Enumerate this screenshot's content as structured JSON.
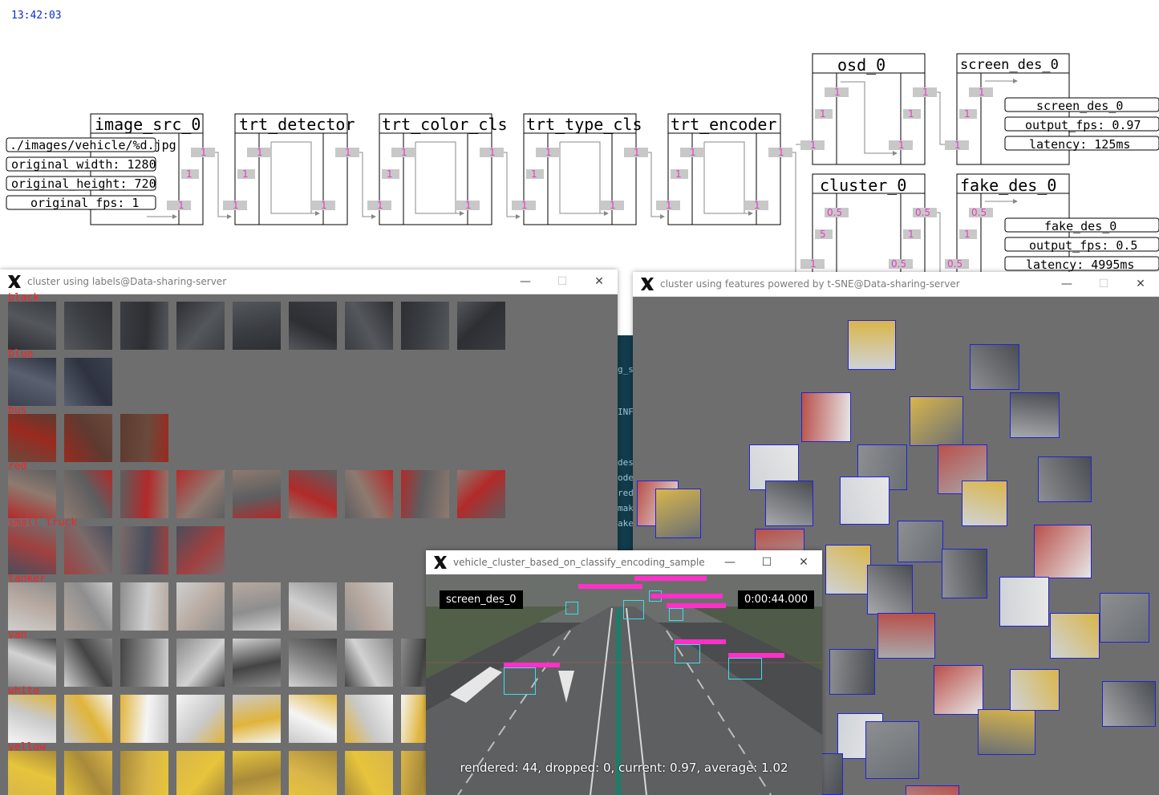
{
  "clock": "13:42:03",
  "pipeline": {
    "nodes": [
      {
        "name": "image_src_0"
      },
      {
        "name": "trt_detector"
      },
      {
        "name": "trt_color_cls"
      },
      {
        "name": "trt_type_cls"
      },
      {
        "name": "trt_encoder"
      },
      {
        "name": "osd_0"
      },
      {
        "name": "screen_des_0"
      },
      {
        "name": "cluster_0"
      },
      {
        "name": "fake_des_0"
      }
    ],
    "image_src_info": [
      "./images/vehicle/%d.jpg",
      "original_width: 1280",
      "original_height: 720",
      "original_fps: 1"
    ],
    "screen_des_info": [
      "screen_des_0",
      "output_fps: 0.97",
      "latency: 125ms"
    ],
    "fake_des_info": [
      "fake_des_0",
      "output_fps: 0.5",
      "latency: 4995ms"
    ],
    "port_values": {
      "one": "1",
      "half": "0.5",
      "five": "5"
    }
  },
  "win_labels": {
    "title": "cluster using labels@Data-sharing-server",
    "categories": [
      "black",
      "blue",
      "bus",
      "red",
      "small_truck",
      "tanker",
      "van",
      "white",
      "yellow"
    ]
  },
  "win_features": {
    "title": "cluster using features powered by t-SNE@Data-sharing-server"
  },
  "win_video": {
    "title": "vehicle_cluster_based_on_classify_encoding_sample",
    "overlay_left": "screen_des_0",
    "overlay_right": "0:00:44.000",
    "stats": "rendered: 44, dropped: 0, current: 0.97, average: 1.02"
  },
  "terminal_fragments": [
    "g_s",
    "INF",
    "des",
    "ode",
    "red",
    "mak",
    "ake"
  ],
  "window_controls": {
    "minimize": "—",
    "maximize": "☐",
    "close": "✕"
  },
  "colors": {
    "accent": "#0b2bd6",
    "category_label": "#ff2020",
    "feature_border": "#2323d8",
    "detection": "#38e0f0",
    "tag": "#ff30c8"
  }
}
